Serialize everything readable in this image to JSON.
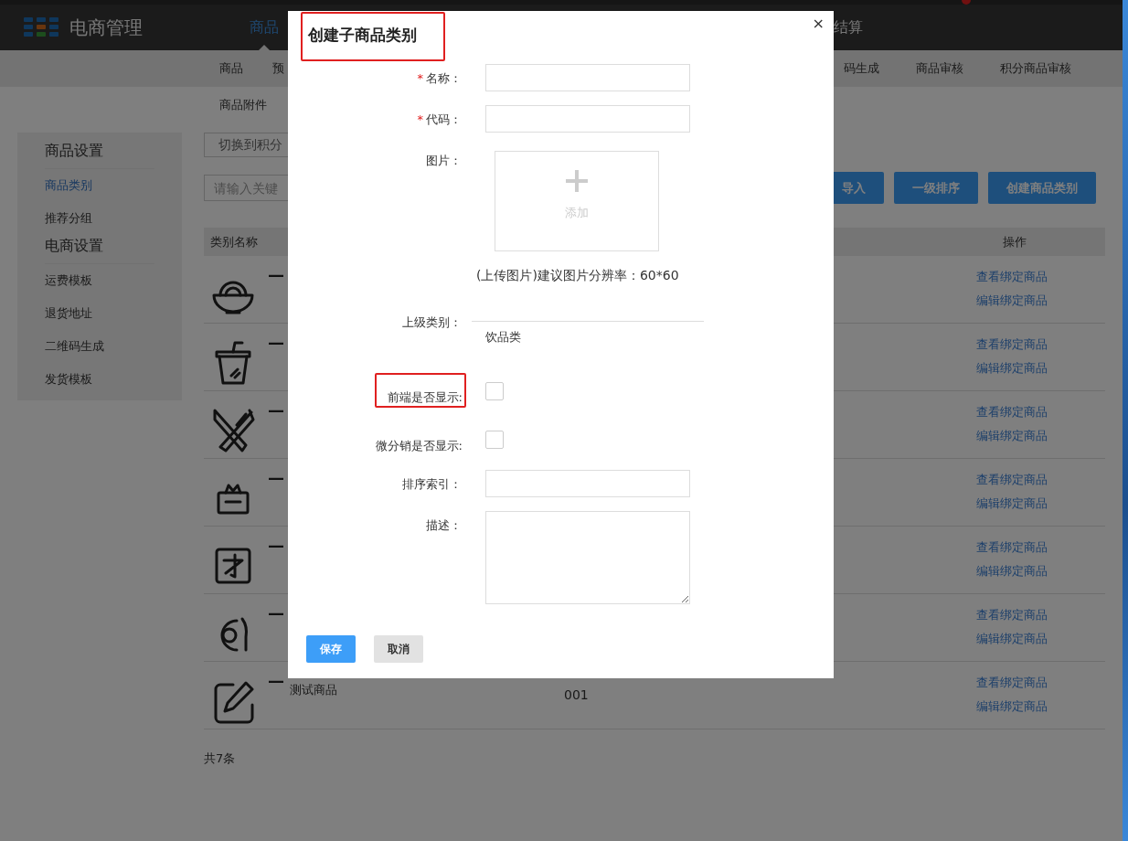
{
  "header": {
    "app_title": "电商管理",
    "nav": [
      {
        "label": "商品",
        "selected": true
      },
      {
        "label": "结算",
        "selected": false
      }
    ]
  },
  "subnav": {
    "row_1_left": [
      "商品",
      "预"
    ],
    "row_1_right": [
      "码生成",
      "商品审核",
      "积分商品审核"
    ],
    "row_2": [
      "商品附件"
    ]
  },
  "sidebar": {
    "sections": [
      {
        "title": "商品设置",
        "items": [
          {
            "label": "商品类别",
            "selected": true
          },
          {
            "label": "推荐分组",
            "selected": false
          }
        ]
      },
      {
        "title": "电商设置",
        "items": [
          {
            "label": "运费模板",
            "selected": false
          },
          {
            "label": "退货地址",
            "selected": false
          },
          {
            "label": "二维码生成",
            "selected": false
          },
          {
            "label": "发货模板",
            "selected": false
          }
        ]
      }
    ]
  },
  "toolbar": {
    "switch_button": "切换到积分",
    "search": {
      "placeholder": "请输入关键"
    },
    "buttons": [
      "导入",
      "一级排序",
      "创建商品类别"
    ]
  },
  "table": {
    "columns": [
      "类别名称",
      "操作"
    ],
    "rows": [
      {
        "kind": "bowl",
        "prefix": "—",
        "actions": [
          "查看绑定商品",
          "编辑绑定商品"
        ]
      },
      {
        "kind": "cup",
        "prefix": "—",
        "actions": [
          "查看绑定商品",
          "编辑绑定商品"
        ]
      },
      {
        "kind": "cutlery",
        "prefix": "—",
        "actions": [
          "查看绑定商品",
          "编辑绑定商品"
        ]
      },
      {
        "kind": "gift",
        "prefix": "—",
        "actions": [
          "查看绑定商品",
          "编辑绑定商品"
        ]
      },
      {
        "kind": "glyph",
        "prefix": "—",
        "actions": [
          "查看绑定商品",
          "编辑绑定商品"
        ]
      },
      {
        "kind": "plate",
        "prefix": "—",
        "actions": [
          "查看绑定商品",
          "编辑绑定商品"
        ]
      },
      {
        "kind": "edit",
        "prefix": "—",
        "name": "测试商品",
        "code": "001",
        "actions": [
          "查看绑定商品",
          "编辑绑定商品"
        ]
      }
    ]
  },
  "footer": "共7条",
  "modal": {
    "title": "创建子商品类别",
    "title_highlighted": true,
    "close": "×",
    "fields": [
      {
        "kind": "text",
        "label": "名称：",
        "required_mark": "*"
      },
      {
        "kind": "text",
        "label": "代码：",
        "required_mark": "*"
      },
      {
        "kind": "image",
        "label": "图片：",
        "upload_label": "添加",
        "hint": "(上传图片)建议图片分辨率：60*60"
      },
      {
        "kind": "parent",
        "label": "上级类别：",
        "value": "饮品类"
      },
      {
        "kind": "checkbox",
        "label": "前端是否显示:",
        "checked": false,
        "highlighted": true
      },
      {
        "kind": "checkbox",
        "label": "微分销是否显示:",
        "checked": false,
        "highlighted": false
      },
      {
        "kind": "text",
        "label": "排序索引："
      },
      {
        "kind": "textarea",
        "label": "描述："
      }
    ],
    "buttons": [
      {
        "label": "保存",
        "kind": "primary"
      },
      {
        "label": "取消",
        "kind": "secondary"
      }
    ]
  }
}
